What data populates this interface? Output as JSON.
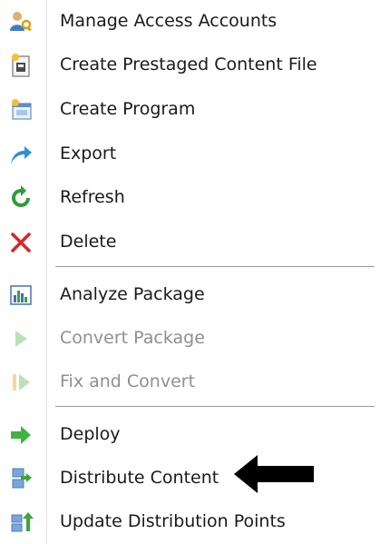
{
  "menu": {
    "items": [
      {
        "label": "Manage Access Accounts",
        "icon": "access-accounts-icon",
        "enabled": true
      },
      {
        "label": "Create Prestaged Content File",
        "icon": "prestaged-content-icon",
        "enabled": true
      },
      {
        "label": "Create Program",
        "icon": "create-program-icon",
        "enabled": true
      },
      {
        "label": "Export",
        "icon": "export-icon",
        "enabled": true
      },
      {
        "label": "Refresh",
        "icon": "refresh-icon",
        "enabled": true
      },
      {
        "label": "Delete",
        "icon": "delete-icon",
        "enabled": true
      },
      {
        "label": "Analyze Package",
        "icon": "analyze-package-icon",
        "enabled": true
      },
      {
        "label": "Convert Package",
        "icon": "convert-package-icon",
        "enabled": false
      },
      {
        "label": "Fix and Convert",
        "icon": "fix-convert-icon",
        "enabled": false
      },
      {
        "label": "Deploy",
        "icon": "deploy-icon",
        "enabled": true
      },
      {
        "label": "Distribute Content",
        "icon": "distribute-content-icon",
        "enabled": true
      },
      {
        "label": "Update Distribution Points",
        "icon": "update-distribution-points-icon",
        "enabled": true
      }
    ]
  },
  "annotation": {
    "icon": "arrow-left-icon",
    "color": "#000000",
    "points_to": "Distribute Content"
  },
  "colors": {
    "text": "#1a1a1a",
    "disabled_text": "#8f8f8f",
    "separator": "#9a9a9a"
  }
}
